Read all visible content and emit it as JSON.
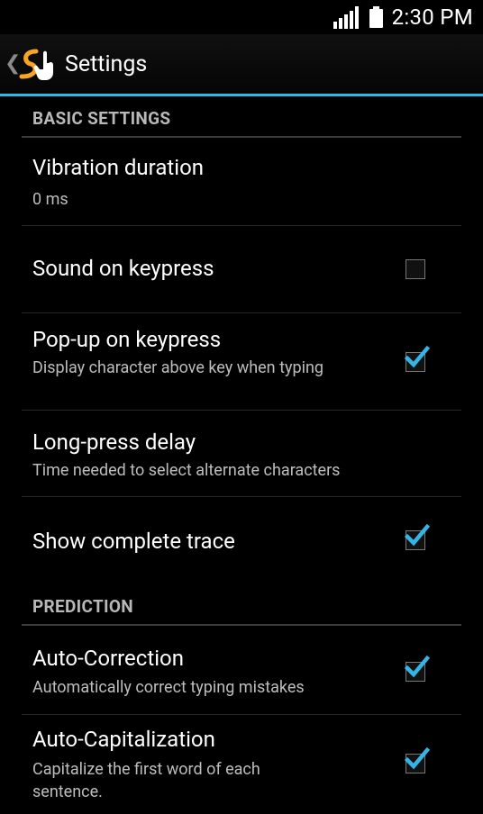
{
  "status_bar": {
    "time": "2:30 PM",
    "signal_icon": "signal-bars-icon",
    "battery_icon": "battery-full-icon"
  },
  "action_bar": {
    "title": "Settings",
    "up_icon": "chevron-left-icon",
    "app_icon": "swipe-keyboard-logo-icon"
  },
  "sections": [
    {
      "header": "BASIC SETTINGS",
      "items": [
        {
          "title": "Vibration duration",
          "summary": "0 ms"
        },
        {
          "title": "Sound on keypress",
          "checked": false
        },
        {
          "title": "Pop-up on keypress",
          "summary": "Display character above key when typing",
          "checked": true
        },
        {
          "title": "Long-press delay",
          "summary": "Time needed to select alternate characters"
        },
        {
          "title": "Show complete trace",
          "checked": true
        }
      ]
    },
    {
      "header": "PREDICTION",
      "items": [
        {
          "title": "Auto-Correction",
          "summary": "Automatically correct typing mistakes",
          "checked": true
        },
        {
          "title": "Auto-Capitalization",
          "summary": "Capitalize the first word of each sentence.",
          "checked": true
        }
      ]
    }
  ],
  "colors": {
    "accent": "#33b5e5",
    "background": "#000000",
    "summary_text": "#bdbdbd",
    "header_text": "#b8b8b8"
  }
}
